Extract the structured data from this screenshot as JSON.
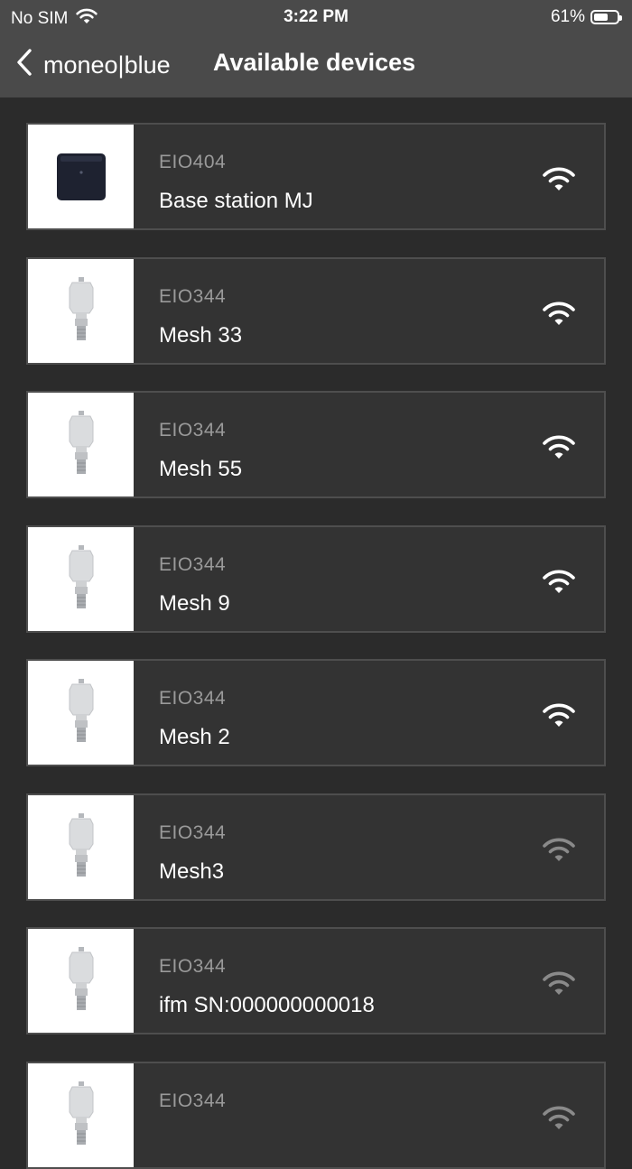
{
  "status_bar": {
    "carrier": "No SIM",
    "time": "3:22 PM",
    "battery": "61%",
    "battery_level": 0.61
  },
  "nav": {
    "back_label": "moneo|blue",
    "title": "Available devices"
  },
  "devices": [
    {
      "model": "EIO404",
      "name": "Base station MJ",
      "image": "base-station",
      "signal": "strong"
    },
    {
      "model": "EIO344",
      "name": "Mesh 33",
      "image": "mesh-sensor",
      "signal": "strong"
    },
    {
      "model": "EIO344",
      "name": "Mesh 55",
      "image": "mesh-sensor",
      "signal": "strong"
    },
    {
      "model": "EIO344",
      "name": "Mesh 9",
      "image": "mesh-sensor",
      "signal": "strong"
    },
    {
      "model": "EIO344",
      "name": "Mesh 2",
      "image": "mesh-sensor",
      "signal": "strong"
    },
    {
      "model": "EIO344",
      "name": "Mesh3",
      "image": "mesh-sensor",
      "signal": "weak"
    },
    {
      "model": "EIO344",
      "name": "ifm SN:000000000018",
      "image": "mesh-sensor",
      "signal": "weak"
    },
    {
      "model": "EIO344",
      "name": "",
      "image": "mesh-sensor",
      "signal": "weak"
    }
  ],
  "colors": {
    "background": "#2b2b2b",
    "header": "#4a4a4a",
    "card": "#333333",
    "card_border": "#4e4e4e",
    "model_text": "#9a9a9a",
    "signal_strong": "#ffffff",
    "signal_weak": "#8a8a8a"
  },
  "icons": {
    "back": "chevron-left-icon",
    "carrier_wifi": "wifi-icon",
    "battery": "battery-icon",
    "signal": "wifi-signal-icon"
  }
}
